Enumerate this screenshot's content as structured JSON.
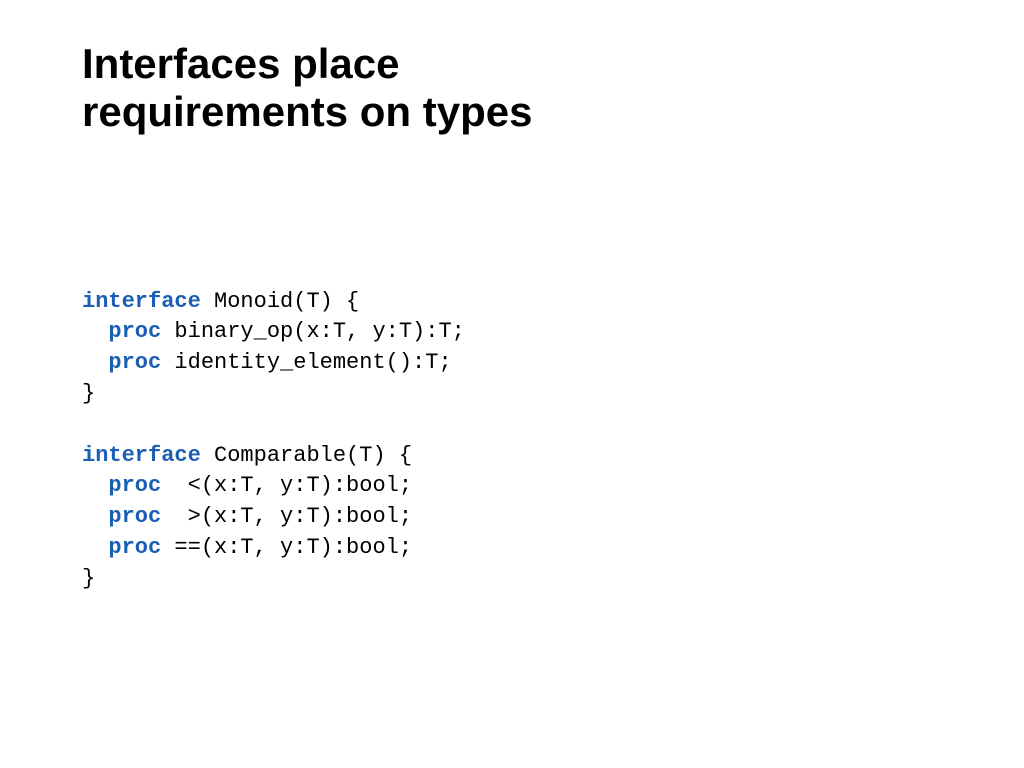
{
  "title": "Interfaces place\nrequirements on types",
  "keywords": {
    "interface": "interface",
    "proc": "proc"
  },
  "code": {
    "monoid_decl": " Monoid(T) {",
    "binary_op": " binary_op(x:T, y:T):T;",
    "identity_element": " identity_element():T;",
    "close": "}",
    "comparable_decl": " Comparable(T) {",
    "lt": "  <(x:T, y:T):bool;",
    "gt": "  >(x:T, y:T):bool;",
    "eq": " ==(x:T, y:T):bool;"
  }
}
